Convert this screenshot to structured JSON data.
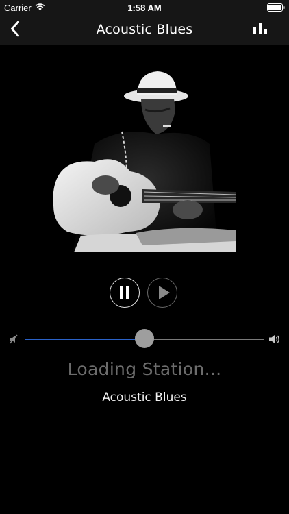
{
  "status_bar": {
    "carrier": "Carrier",
    "time": "1:58 AM",
    "icons": {
      "wifi": "wifi-icon",
      "battery": "battery-icon"
    }
  },
  "nav": {
    "title": "Acoustic Blues",
    "back_icon": "chevron-left-icon",
    "right_icon": "equalizer-icon"
  },
  "album_art": {
    "description_icon": "album-art-image"
  },
  "player": {
    "pause_icon": "pause-icon",
    "play_icon": "play-icon"
  },
  "volume": {
    "level": 0.5,
    "min_icon": "volume-mute-icon",
    "max_icon": "volume-max-icon",
    "fill_color": "#2a62c8"
  },
  "status_text": "Loading Station...",
  "station_name": "Acoustic Blues"
}
